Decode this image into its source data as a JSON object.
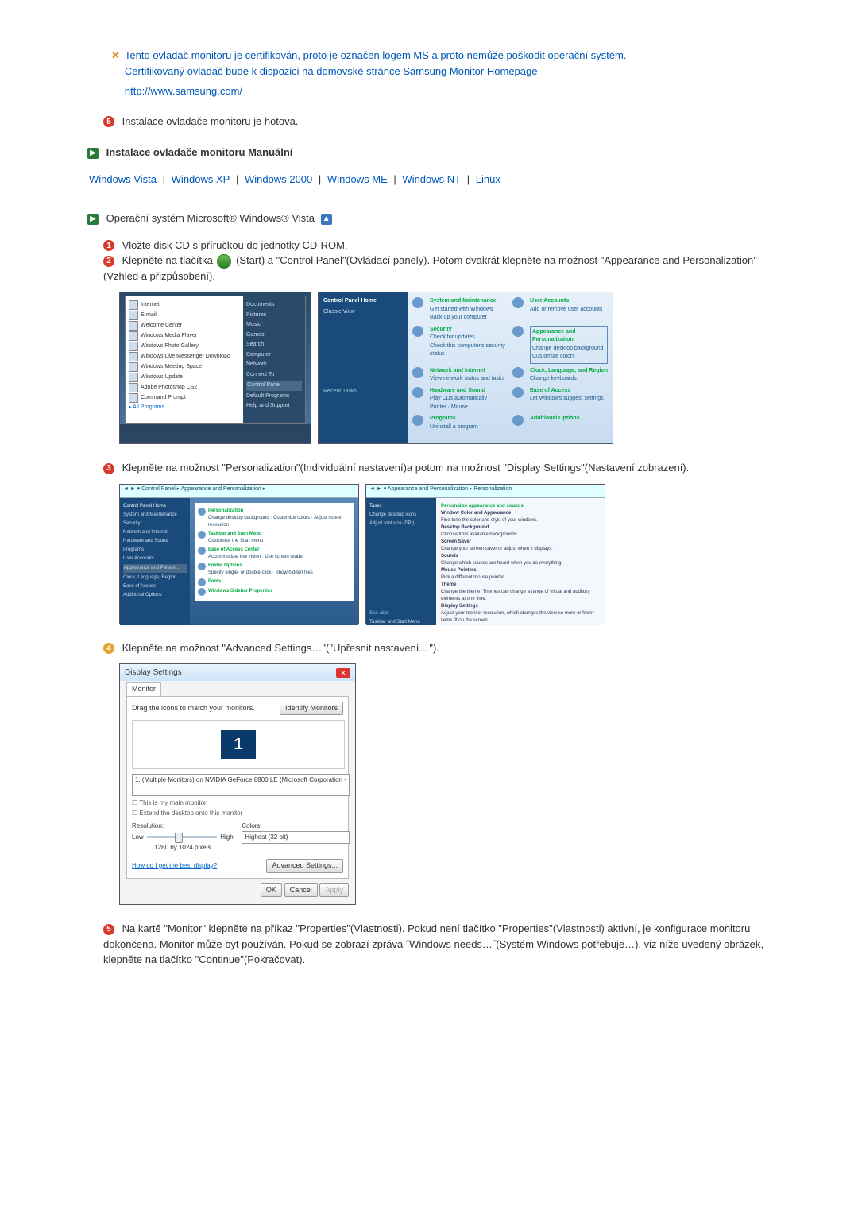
{
  "note": {
    "line1": "Tento ovladač monitoru je certifikován, proto je označen logem MS a proto nemůže poškodit operační systém.",
    "line2": "Certifikovaný ovladač bude k dispozici na domovské stránce Samsung Monitor Homepage",
    "url": "http://www.samsung.com/"
  },
  "install_done": "Instalace ovladače monitoru je hotova.",
  "manual_heading": "Instalace ovladače monitoru Manuální",
  "oslinks": {
    "vista": "Windows Vista",
    "xp": "Windows XP",
    "w2k": "Windows 2000",
    "me": "Windows ME",
    "nt": "Windows NT",
    "linux": "Linux",
    "sep": "|"
  },
  "vista_heading": "Operační systém Microsoft® Windows® Vista",
  "step1": "Vložte disk CD s příručkou do jednotky CD-ROM.",
  "step2a": "Klepněte na tlačítka ",
  "step2b": "(Start) a \"Control Panel\"(Ovládací panely). Potom dvakrát klepněte na možnost \"Appearance and Personalization\"(Vzhled a přizpůsobení).",
  "step3": "Klepněte na možnost \"Personalization\"(Individuální nastavení)a potom na možnost \"Display Settings\"(Nastavení zobrazení).",
  "step4": "Klepněte na možnost \"Advanced Settings…\"(\"Upřesnit nastavení…\").",
  "step5": "Na kartě \"Monitor\" klepněte na příkaz \"Properties\"(Vlastnosti). Pokud není tlačítko \"Properties\"(Vlastnosti) aktivní, je konfigurace monitoru dokončena. Monitor může být používán. Pokud se zobrazí zpráva ˝Windows needs…˝(Systém Windows potřebuje…), viz níže uvedený obrázek, klepněte na tlačítko \"Continue\"(Pokračovat).",
  "dialog": {
    "title": "Display Settings",
    "tab": "Monitor",
    "drag": "Drag the icons to match your monitors.",
    "identify": "Identify Monitors",
    "mon_num": "1",
    "adapter": "1. (Multiple Monitors) on NVIDIA GeForce 8800 LE (Microsoft Corporation - …",
    "chk1": "This is my main monitor",
    "chk2": "Extend the desktop onto this monitor",
    "res_label": "Resolution:",
    "low": "Low",
    "high": "High",
    "res_value": "1280 by 1024 pixels",
    "colors_label": "Colors:",
    "colors_value": "Highest (32 bit)",
    "best": "How do I get the best display?",
    "adv": "Advanced Settings...",
    "ok": "OK",
    "cancel": "Cancel",
    "apply": "Apply"
  },
  "cp": {
    "side_hdr": "Control Panel Home",
    "side_classic": "Classic View",
    "cat1": "System and Maintenance",
    "cat2": "Security",
    "cat3": "Network and Internet",
    "cat4": "Hardware and Sound",
    "cat5": "Programs",
    "cat6": "User Accounts",
    "cat7": "Appearance and Personalization",
    "cat8": "Clock, Language, and Region",
    "cat9": "Ease of Access",
    "cat10": "Additional Options"
  }
}
